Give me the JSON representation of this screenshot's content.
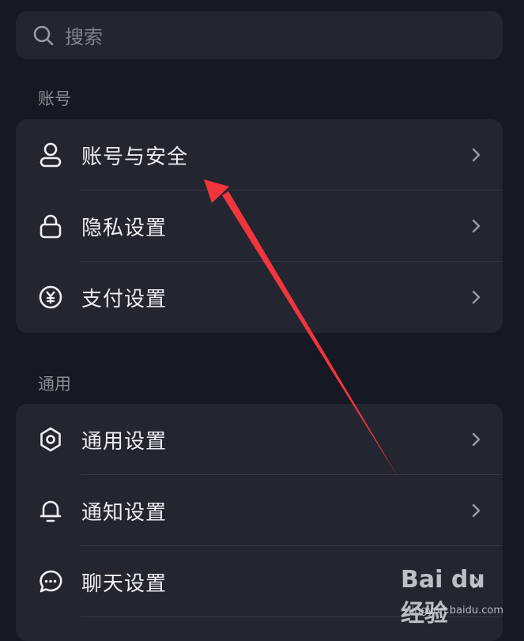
{
  "search": {
    "placeholder": "搜索"
  },
  "sections": [
    {
      "title": "账号",
      "items": [
        {
          "label": "账号与安全",
          "icon": "person-icon"
        },
        {
          "label": "隐私设置",
          "icon": "lock-icon"
        },
        {
          "label": "支付设置",
          "icon": "yen-icon"
        }
      ]
    },
    {
      "title": "通用",
      "items": [
        {
          "label": "通用设置",
          "icon": "gear-icon"
        },
        {
          "label": "通知设置",
          "icon": "bell-icon"
        },
        {
          "label": "聊天设置",
          "icon": "chat-bubble-icon"
        }
      ]
    }
  ],
  "watermark": {
    "logo": "Bai du 经验",
    "url": "jingyan.baidu.com"
  },
  "colors": {
    "background": "#161823",
    "card": "#232531",
    "annotation_arrow": "#f0353c"
  }
}
